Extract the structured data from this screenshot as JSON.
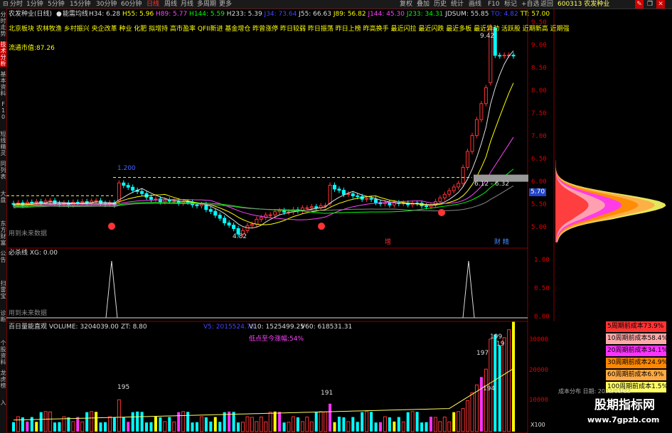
{
  "stock_code_title": "600313 农发种业",
  "toolbar": {
    "periods": [
      "分时",
      "1分钟",
      "5分钟",
      "15分钟",
      "30分钟",
      "60分钟",
      "日线",
      "周线",
      "月线",
      "多周期",
      "更多"
    ],
    "actions": [
      "复权",
      "叠加",
      "历史",
      "统计",
      "画线",
      "F10",
      "标记",
      "+自选",
      "返回"
    ]
  },
  "left_tabs": [
    "分时走势",
    "技术分析",
    "基本资料",
    "F10",
    "短线精灵",
    "同列表",
    "大盘",
    "东方财富",
    "公告",
    "扫雷宝",
    "诊断",
    "个股资料",
    "龙虎榜",
    "入"
  ],
  "main_panel": {
    "title": "农发种业(日线)",
    "indicator": "能需均线",
    "readouts": [
      {
        "label": "H34: 6.28",
        "color": "#dddddd"
      },
      {
        "label": "H55: 5.96",
        "color": "#ffff00"
      },
      {
        "label": "H89: 5.77",
        "color": "#ff44ff"
      },
      {
        "label": "H144: 5.59",
        "color": "#00ff00"
      },
      {
        "label": "H233: 5.39",
        "color": "#dddddd"
      },
      {
        "label": "J34: 73.64",
        "color": "#4444ff"
      },
      {
        "label": "J55: 66.63",
        "color": "#dddddd"
      },
      {
        "label": "J89: 56.82",
        "color": "#ffff00"
      },
      {
        "label": "J144: 45.30",
        "color": "#ff44ff"
      },
      {
        "label": "J233: 34.31",
        "color": "#00ff00"
      },
      {
        "label": "JDSUM: 55.85",
        "color": "#dddddd"
      },
      {
        "label": "TO: 4.82",
        "color": "#4444ff"
      },
      {
        "label": "TT: 57.00",
        "color": "#ffff00"
      }
    ],
    "sectors": "北京板块 农林牧渔 乡村振兴 央企改革 种业 化肥 拟增持 高市盈率 QFII新进 基金增仓 昨曾涨停 昨日较弱 昨日振荡 昨日上榜 昨高换手 最近闪拉 最近闪跌 最近多板 最近异动 活跃股 近期新高 近期强",
    "circulation": "流通市值:87.26",
    "peak_label": "9.42",
    "level_label": "1.200",
    "low_label": "4.82",
    "range_label": "6.12 - 6.32",
    "current_price": "5.70",
    "future_data": "用到未来数据",
    "tag_zeng": "增",
    "tag_caibao": "财 精",
    "yaxis": [
      "9.50",
      "9.00",
      "8.50",
      "8.00",
      "7.50",
      "7.00",
      "6.50",
      "6.00",
      "5.50",
      "5.00"
    ]
  },
  "xg_panel": {
    "title": "必杀线 XG: 0.00",
    "future_data": "用到未来数据",
    "yaxis": [
      "1.00",
      "0.50",
      "0.00"
    ]
  },
  "vol_panel": {
    "title": "百日量能直观 VOLUME: 3204039.00",
    "zt": "ZT: 8.80",
    "v5": "V5: 2015524.75",
    "v10": "V10: 1525499.25",
    "v60": "V60: 618531.31",
    "gain_note": "低点至今涨幅:54%",
    "peak_labels": [
      "195",
      "191",
      "197",
      "199",
      "19",
      "194"
    ],
    "yaxis": [
      "30000",
      "20000",
      "10000"
    ],
    "unit": "X100"
  },
  "cost_legend": [
    {
      "label": "5周期前成本73.9%",
      "color": "#ff3333"
    },
    {
      "label": "10周期前成本58.4%",
      "color": "#ffaaaa"
    },
    {
      "label": "20周期前成本34.1%",
      "color": "#ff33ff"
    },
    {
      "label": "30周期前成本24.9%",
      "color": "#ff8800"
    },
    {
      "label": "60周期前成本6.9%",
      "color": "#ffaa44"
    },
    {
      "label": "100周期前成本1.5%",
      "color": "#ffff66"
    }
  ],
  "cost_footer": "成本分布 日期: 2022/03/22",
  "watermark": "股期指标网",
  "watermark_url": "www.7gpzb.com",
  "colors": {
    "up": "#ff3333",
    "down": "#00ffff",
    "axis": "#cc0000",
    "gray_box": "#999999"
  }
}
